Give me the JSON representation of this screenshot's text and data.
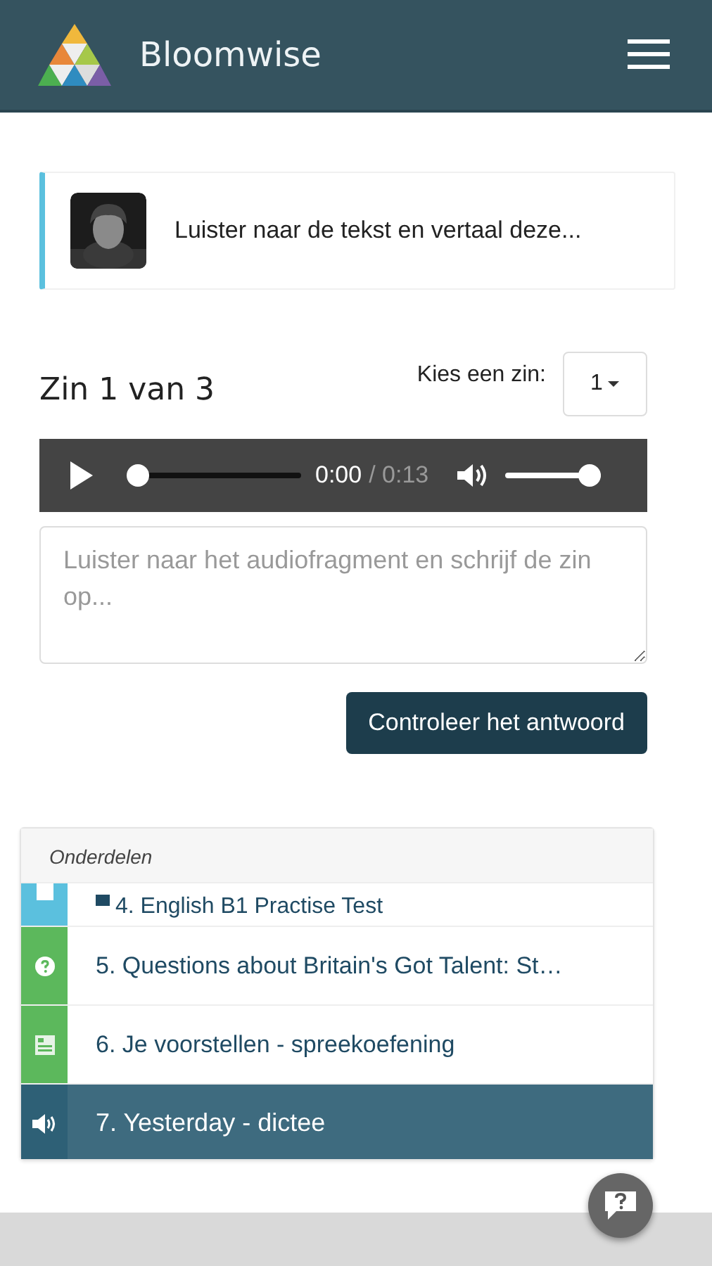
{
  "header": {
    "brand": "Bloomwise"
  },
  "intro": {
    "text": "Luister naar de tekst en vertaal deze..."
  },
  "exercise": {
    "title": "Zin 1 van 3",
    "picker_label": "Kies een zin:",
    "picker_value": "1"
  },
  "player": {
    "progress": {
      "level": 0
    },
    "current": "0:00",
    "duration": "/ 0:13",
    "volume": {
      "level": 1
    }
  },
  "answer": {
    "placeholder": "Luister naar het audiofragment en schrijf de zin op..."
  },
  "check_button": "Controleer het antwoord",
  "parts": {
    "heading": "Onderdelen",
    "items": [
      {
        "label": "4. English B1 Practise Test",
        "kind": "test",
        "color": "#5bc0de",
        "selected": false
      },
      {
        "label": "5. Questions about Britain's Got Talent: St…",
        "kind": "question",
        "color": "#5cb85c",
        "selected": false
      },
      {
        "label": "6. Je voorstellen - spreekoefening",
        "kind": "sheet",
        "color": "#5cb85c",
        "selected": false
      },
      {
        "label": "7. Yesterday - dictee",
        "kind": "audio",
        "color": "#2e6076",
        "selected": true
      }
    ]
  }
}
